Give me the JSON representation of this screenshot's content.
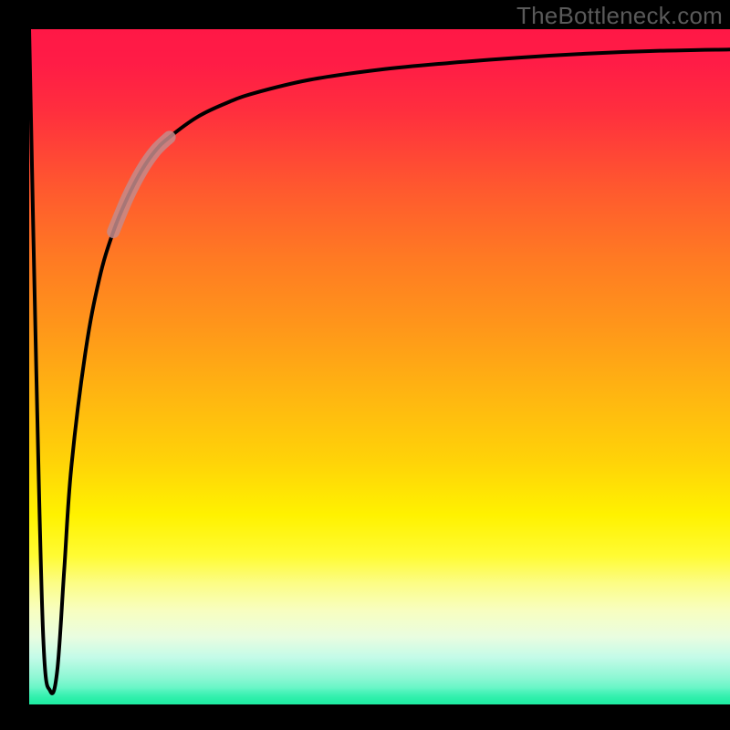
{
  "watermark": "TheBottleneck.com",
  "colors": {
    "frame": "#000000",
    "watermark": "#5a5a5a",
    "curve": "#000000",
    "highlight": "#c48b8b",
    "gradient_top": "#ff1846",
    "gradient_bottom": "#2bf3b1"
  },
  "chart_data": {
    "type": "line",
    "title": "",
    "xlabel": "",
    "ylabel": "",
    "xlim": [
      0,
      100
    ],
    "ylim": [
      0,
      100
    ],
    "grid": false,
    "legend": false,
    "series": [
      {
        "name": "bottleneck-curve",
        "x": [
          0,
          1,
          2,
          3,
          4,
          5,
          6,
          8,
          10,
          12,
          14,
          16,
          18,
          20,
          24,
          28,
          32,
          40,
          50,
          60,
          70,
          80,
          90,
          100
        ],
        "y": [
          100,
          50,
          10,
          2,
          5,
          20,
          35,
          52,
          63,
          70,
          75,
          79,
          82,
          84,
          87,
          89,
          90.5,
          92.5,
          94,
          95,
          95.8,
          96.4,
          96.8,
          97
        ]
      }
    ],
    "annotations": [
      {
        "name": "highlight-segment",
        "x_range": [
          14,
          20
        ],
        "style": "thick-dimmed"
      }
    ]
  }
}
